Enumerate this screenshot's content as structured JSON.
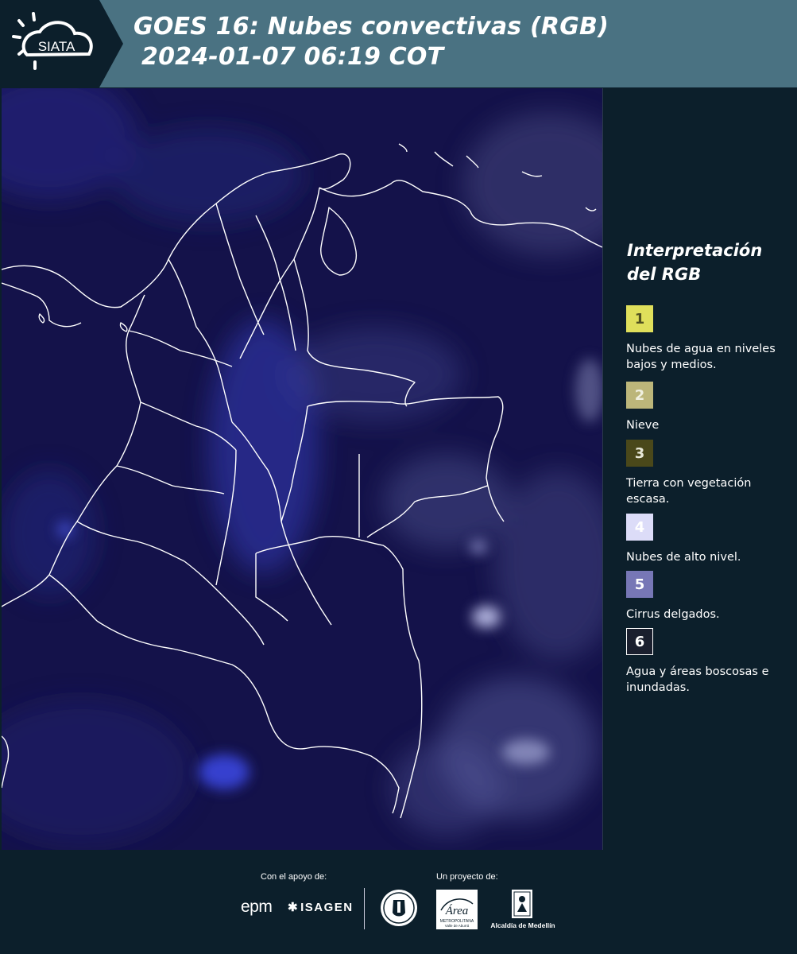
{
  "header": {
    "logo_text": "SIATA",
    "title_line1": "GOES 16: Nubes convectivas (RGB)",
    "title_line2": "2024-01-07 06:19 COT",
    "bar_color": "#4a7282"
  },
  "legend": {
    "title_line1": "Interpretación",
    "title_line2": "del RGB",
    "items": [
      {
        "number": "1",
        "label": "Nubes de agua en niveles bajos y medios.",
        "color": "#dfdf5b",
        "text_color": "#505020"
      },
      {
        "number": "2",
        "label": "Nieve",
        "color": "#bcb67a",
        "text_color": "#f0f0e0"
      },
      {
        "number": "3",
        "label": "Tierra con vegetación escasa.",
        "color": "#4a481a",
        "text_color": "#e8e8d8"
      },
      {
        "number": "4",
        "label": "Nubes de alto nivel.",
        "color": "#dcdcf8",
        "text_color": "#ffffff"
      },
      {
        "number": "5",
        "label": "Cirrus delgados.",
        "color": "#7777b6",
        "text_color": "#ffffff"
      },
      {
        "number": "6",
        "label": "Agua y áreas boscosas e inundadas.",
        "color": "#1a1f2e",
        "text_color": "#ffffff"
      }
    ]
  },
  "map": {
    "background_color": "#14124a",
    "border_color": "#ffffff",
    "cloud_color": "#3d48d8"
  },
  "footer": {
    "support_label": "Con el apoyo de:",
    "project_label": "Un proyecto de:",
    "epm_logo": "epm",
    "isagen_logo": "ISAGEN",
    "amva_logo_lines": [
      "Área",
      "METROPOLITANA",
      "Valle de Aburrá"
    ],
    "alcaldia_logo": "Alcaldía de Medellín"
  }
}
